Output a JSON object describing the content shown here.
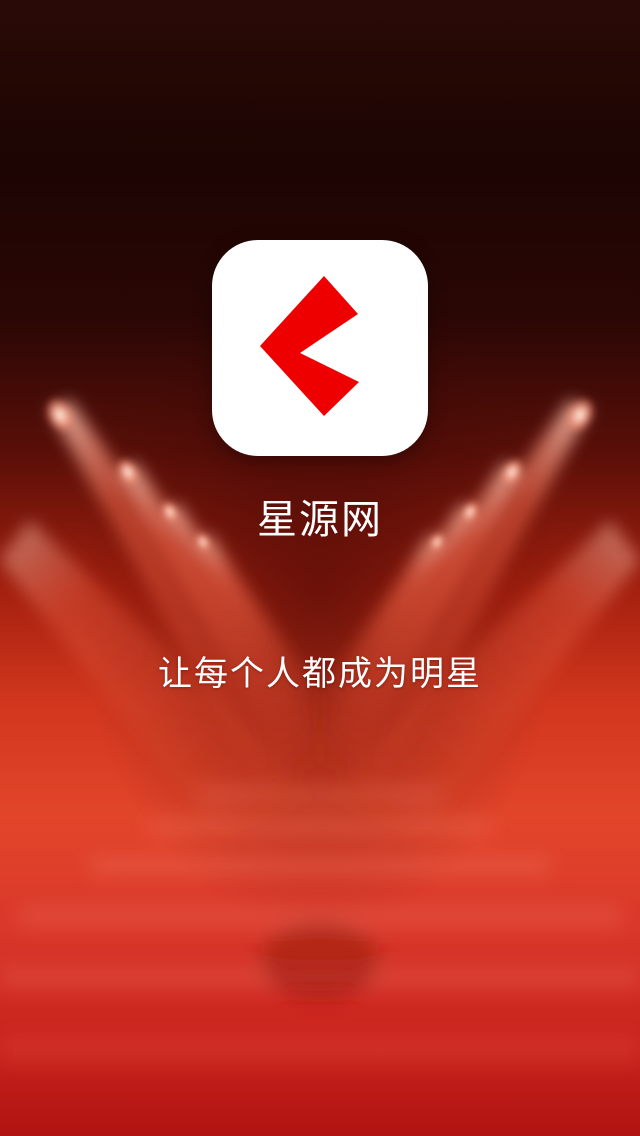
{
  "splash": {
    "app_name": "星源网",
    "slogan": "让每个人都成为明星"
  },
  "logo": {
    "icon": "red-chevron-logo",
    "background_color": "#ffffff",
    "mark_color": "#ee0000"
  },
  "colors": {
    "background_top": "#1c0503",
    "background_bottom": "#c8221c",
    "spotlight": "#f46a4f",
    "text": "#ffffff"
  }
}
